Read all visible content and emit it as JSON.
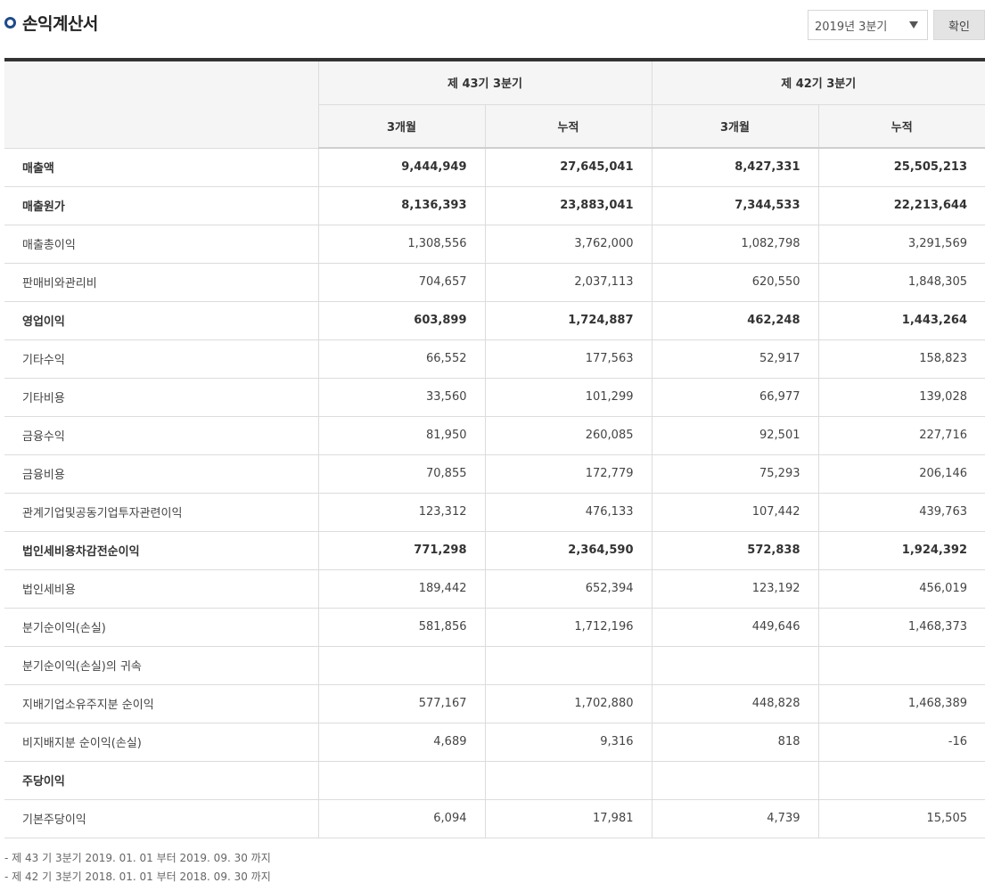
{
  "header": {
    "title": "손익계산서",
    "period_select": {
      "value": "2019년 3분기"
    },
    "confirm_label": "확인"
  },
  "table": {
    "group_headers": [
      "제 43기 3분기",
      "제 42기 3분기"
    ],
    "sub_headers": [
      "3개월",
      "누적",
      "3개월",
      "누적"
    ],
    "rows": [
      {
        "label": "매출액",
        "bold": true,
        "values": [
          "9,444,949",
          "27,645,041",
          "8,427,331",
          "25,505,213"
        ]
      },
      {
        "label": "매출원가",
        "bold": true,
        "values": [
          "8,136,393",
          "23,883,041",
          "7,344,533",
          "22,213,644"
        ]
      },
      {
        "label": "매출총이익",
        "bold": false,
        "values": [
          "1,308,556",
          "3,762,000",
          "1,082,798",
          "3,291,569"
        ]
      },
      {
        "label": "판매비와관리비",
        "bold": false,
        "values": [
          "704,657",
          "2,037,113",
          "620,550",
          "1,848,305"
        ]
      },
      {
        "label": "영업이익",
        "bold": true,
        "values": [
          "603,899",
          "1,724,887",
          "462,248",
          "1,443,264"
        ]
      },
      {
        "label": "기타수익",
        "bold": false,
        "values": [
          "66,552",
          "177,563",
          "52,917",
          "158,823"
        ]
      },
      {
        "label": "기타비용",
        "bold": false,
        "values": [
          "33,560",
          "101,299",
          "66,977",
          "139,028"
        ]
      },
      {
        "label": "금융수익",
        "bold": false,
        "values": [
          "81,950",
          "260,085",
          "92,501",
          "227,716"
        ]
      },
      {
        "label": "금융비용",
        "bold": false,
        "values": [
          "70,855",
          "172,779",
          "75,293",
          "206,146"
        ]
      },
      {
        "label": "관계기업및공동기업투자관련이익",
        "bold": false,
        "values": [
          "123,312",
          "476,133",
          "107,442",
          "439,763"
        ]
      },
      {
        "label": "법인세비용차감전순이익",
        "bold": true,
        "values": [
          "771,298",
          "2,364,590",
          "572,838",
          "1,924,392"
        ]
      },
      {
        "label": "법인세비용",
        "bold": false,
        "values": [
          "189,442",
          "652,394",
          "123,192",
          "456,019"
        ]
      },
      {
        "label": "분기순이익(손실)",
        "bold": false,
        "values": [
          "581,856",
          "1,712,196",
          "449,646",
          "1,468,373"
        ]
      },
      {
        "label": "분기순이익(손실)의 귀속",
        "bold": false,
        "values": [
          "",
          "",
          "",
          ""
        ]
      },
      {
        "label": "지배기업소유주지분 순이익",
        "bold": false,
        "values": [
          "577,167",
          "1,702,880",
          "448,828",
          "1,468,389"
        ]
      },
      {
        "label": "비지배지분 순이익(손실)",
        "bold": false,
        "values": [
          "4,689",
          "9,316",
          "818",
          "-16"
        ]
      },
      {
        "label": "주당이익",
        "bold": true,
        "values": [
          "",
          "",
          "",
          ""
        ]
      },
      {
        "label": "기본주당이익",
        "bold": false,
        "values": [
          "6,094",
          "17,981",
          "4,739",
          "15,505"
        ]
      }
    ]
  },
  "footnotes": [
    "- 제 43 기 3분기 2019. 01. 01 부터 2019. 09. 30 까지",
    "- 제 42 기 3분기 2018. 01. 01 부터 2018. 09. 30 까지"
  ]
}
